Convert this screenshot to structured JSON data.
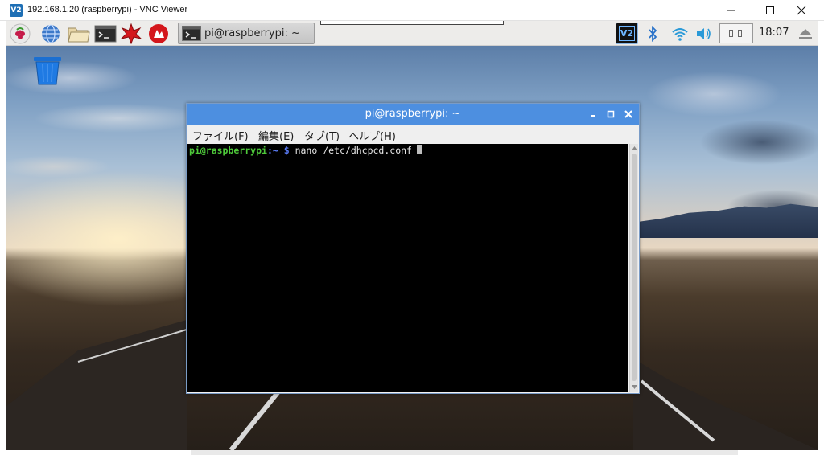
{
  "vnc_window": {
    "logo_text": "V2",
    "title": "192.168.1.20 (raspberrypi) - VNC Viewer"
  },
  "panel": {
    "launchers": [
      "raspberry-menu",
      "web-browser",
      "file-manager",
      "terminal",
      "mathematica",
      "wolfram"
    ],
    "taskbar_item_label": "pi@raspberrypi: ~",
    "tray_vnc_label": "V2",
    "clock": "18:07"
  },
  "terminal": {
    "title": "pi@raspberrypi: ~",
    "menu": {
      "file": "ファイル(F)",
      "edit": "編集(E)",
      "tab": "タブ(T)",
      "help": "ヘルプ(H)"
    },
    "prompt_user": "pi@raspberrypi",
    "prompt_path": ":~ $",
    "command": "nano /etc/dhcpcd.conf"
  },
  "colors": {
    "terminal_titlebar": "#4d8fe0",
    "prompt_user": "#4ec93a",
    "prompt_path": "#5a7bf5",
    "panel_bg": "#edecea"
  }
}
